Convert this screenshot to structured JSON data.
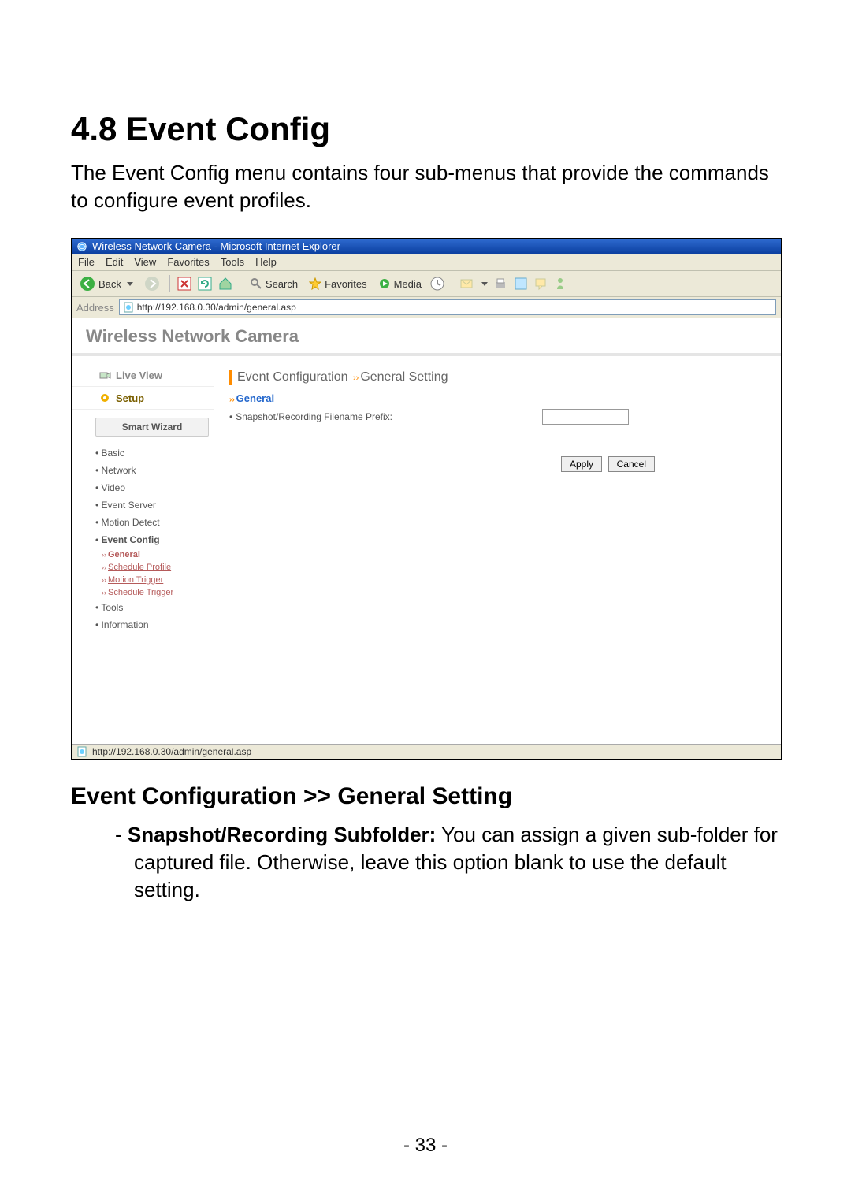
{
  "doc": {
    "section_title": "4.8  Event Config",
    "intro": "The Event Config menu contains four sub-menus that provide the commands to configure event profiles.",
    "sub_title": "Event Configuration >> General Setting",
    "bullet_label": "Snapshot/Recording Subfolder:",
    "bullet_text": " You can assign a given sub-folder for captured file. Otherwise, leave this option blank to use the default setting.",
    "page_number": "- 33 -"
  },
  "browser": {
    "window_title": "Wireless Network Camera - Microsoft Internet Explorer",
    "menus": [
      "File",
      "Edit",
      "View",
      "Favorites",
      "Tools",
      "Help"
    ],
    "toolbar": {
      "back": "Back",
      "search": "Search",
      "favorites": "Favorites",
      "media": "Media"
    },
    "address_label": "Address",
    "address_url": "http://192.168.0.30/admin/general.asp",
    "status_url": "http://192.168.0.30/admin/general.asp"
  },
  "app": {
    "brand": "Wireless Network Camera",
    "tabs": {
      "live_view": "Live View",
      "setup": "Setup"
    },
    "smart_wizard": "Smart Wizard",
    "nav": {
      "basic": "Basic",
      "network": "Network",
      "video": "Video",
      "event_server": "Event Server",
      "motion_detect": "Motion Detect",
      "event_config": "Event Config",
      "tools": "Tools",
      "information": "Information"
    },
    "subnav": {
      "general": "General",
      "schedule_profile": "Schedule Profile",
      "motion_trigger": "Motion Trigger",
      "schedule_trigger": "Schedule Trigger"
    },
    "main": {
      "crumb_a": "Event Configuration ",
      "crumb_b": "General Setting",
      "section_header": "General",
      "field_label": "Snapshot/Recording Filename Prefix:",
      "field_value": "",
      "apply": "Apply",
      "cancel": "Cancel"
    }
  }
}
